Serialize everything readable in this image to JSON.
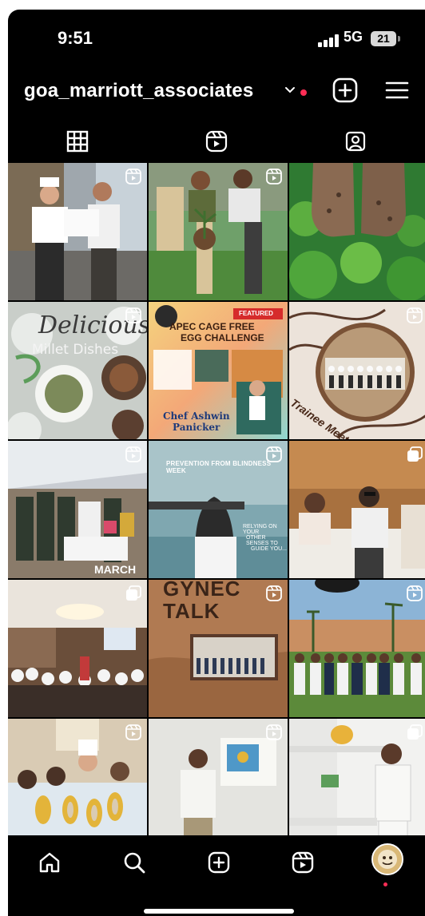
{
  "status_bar": {
    "time": "9:51",
    "network": "5G",
    "battery": "21"
  },
  "header": {
    "username": "goa_marriott_associates"
  },
  "tabs": [
    {
      "name": "grid-icon"
    },
    {
      "name": "reels-icon"
    },
    {
      "name": "tagged-icon"
    }
  ],
  "posts": {
    "p4": {
      "line1": "Delicious",
      "line2": "Millet Dishes"
    },
    "p5": {
      "badge": "FEATURED",
      "title1": "APEC CAGE FREE",
      "title2": "EGG CHALLENGE",
      "name1": "Chef Ashwin",
      "name2": "Panicker"
    },
    "p6": {
      "caption": "Trainee Meet"
    },
    "p7": {
      "caption": "MARCH"
    },
    "p8": {
      "title": "PREVENTION FROM BLINDNESS WEEK",
      "line1": "RELYING ON YOUR",
      "line2": "OTHER SENSES TO",
      "line3": "GUIDE YOU..."
    },
    "p11": {
      "line1": "GYNEC",
      "line2": "TALK"
    }
  },
  "bottom_nav": [
    "home-icon",
    "search-icon",
    "create-icon",
    "reels-icon",
    "profile-avatar"
  ],
  "colors": {
    "background": "#000000",
    "accent_red": "#ff2d55",
    "text": "#ffffff"
  }
}
